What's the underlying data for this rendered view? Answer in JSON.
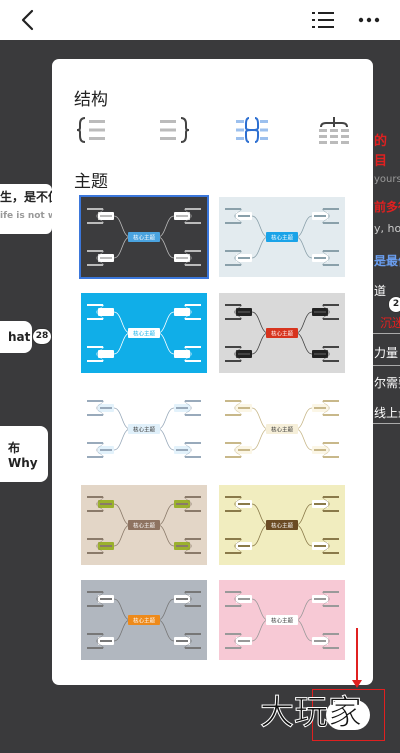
{
  "topbar": {
    "back_icon": "back-arrow-icon",
    "list_icon": "outline-list-icon",
    "more_icon": "more-dots-icon"
  },
  "background": {
    "left_texts": [
      "生，是不值",
      "ife is not wor"
    ],
    "left_nodes": [
      {
        "label": "hat",
        "badge": "28"
      },
      {
        "label": "布 Why"
      }
    ],
    "right_texts": [
      {
        "text": "的",
        "color": "#e02020"
      },
      {
        "text": "目",
        "color": "#e02020"
      },
      {
        "text": "yours.",
        "color": "#9a9a9a"
      },
      {
        "text": "前多得",
        "color": "#e02020"
      },
      {
        "text": "y, how",
        "color": "#cccccc"
      },
      {
        "text": "是最佳",
        "color": "#6a9ef0"
      },
      {
        "text": "道",
        "color": "#ffffff"
      },
      {
        "text": "沉迷",
        "color": "#e02020"
      },
      {
        "text": "力量",
        "color": "#ffffff"
      },
      {
        "text": "尔需要",
        "color": "#ffffff"
      },
      {
        "text": "线上最",
        "color": "#ffffff"
      }
    ],
    "right_badge": "2",
    "watermark": "大玩家"
  },
  "panel": {
    "structure_title": "结构",
    "structures": [
      {
        "name": "left-map",
        "icon": "structure-left-icon",
        "selected": false
      },
      {
        "name": "right-map",
        "icon": "structure-right-icon",
        "selected": false
      },
      {
        "name": "balanced-map",
        "icon": "structure-balanced-icon",
        "selected": true
      },
      {
        "name": "org-chart",
        "icon": "structure-org-chart-icon",
        "selected": false
      }
    ],
    "theme_title": "主题",
    "themes": [
      {
        "bg": "#3c3c3e",
        "center": "#4aa3df",
        "center_text": "#ffffff",
        "branch": "#ffffff",
        "node": "#ffffff",
        "node_text": "#333333",
        "line": "#bbbbbb",
        "label": "核心主题",
        "selected": true
      },
      {
        "bg": "#e3ebef",
        "center": "#1aa3e8",
        "center_text": "#ffffff",
        "branch": "#ffffff",
        "node": "#ffffff",
        "node_text": "#333333",
        "line": "#8aa0aa",
        "label": "核心主题",
        "selected": false
      },
      {
        "bg": "#10aee8",
        "center": "#ffffff",
        "center_text": "#10aee8",
        "branch": "#ffffff",
        "node": "#ffffff",
        "node_text": "#333333",
        "line": "#ffffff",
        "label": "核心主题",
        "selected": false
      },
      {
        "bg": "#d9d9d9",
        "center": "#d7341e",
        "center_text": "#ffffff",
        "branch": "#222222",
        "node": "#ffffff",
        "node_text": "#333333",
        "line": "#444444",
        "label": "核心主题",
        "selected": false
      },
      {
        "bg": "#ffffff",
        "center": "#e0f0fa",
        "center_text": "#333333",
        "branch": "#e3f2fb",
        "node": "#ffffff",
        "node_text": "#333333",
        "line": "#9ab",
        "label": "核心主题",
        "selected": false
      },
      {
        "bg": "#ffffff",
        "center": "#f6efd9",
        "center_text": "#333333",
        "branch": "#fbf6e6",
        "node": "#ffffff",
        "node_text": "#333333",
        "line": "#c8b88a",
        "label": "核心主题",
        "selected": false
      },
      {
        "bg": "#e3d6c7",
        "center": "#8e7361",
        "center_text": "#ffffff",
        "branch": "#9bb12d",
        "node": "#ffffff",
        "node_text": "#333333",
        "line": "#8a7a6a",
        "label": "核心主题",
        "selected": false
      },
      {
        "bg": "#f1edbf",
        "center": "#6b4b24",
        "center_text": "#ffffff",
        "branch": "#ffffff",
        "node": "#ffffff",
        "node_text": "#333333",
        "line": "#8a7a4a",
        "label": "核心主题",
        "selected": false
      },
      {
        "bg": "#b1b7bf",
        "center": "#ee8a1a",
        "center_text": "#ffffff",
        "branch": "#ffffff",
        "node": "#ffffff",
        "node_text": "#333333",
        "line": "#777777",
        "label": "核心主题",
        "selected": false
      },
      {
        "bg": "#f7c9d5",
        "center": "#ffffff",
        "center_text": "#333333",
        "branch": "#ffffff",
        "node": "#ffffff",
        "node_text": "#333333",
        "line": "#999999",
        "label": "核心主题",
        "selected": false
      }
    ]
  }
}
